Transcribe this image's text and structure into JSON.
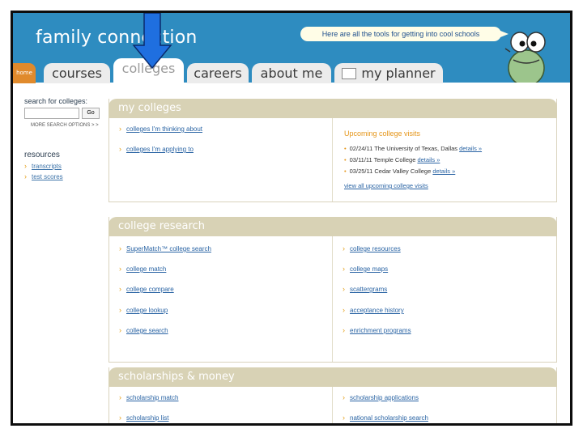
{
  "header": {
    "logo": "family connection",
    "speech": "Here are all the tools for getting into cool schools"
  },
  "tabs": [
    {
      "label": "home"
    },
    {
      "label": "courses"
    },
    {
      "label": "colleges"
    },
    {
      "label": "careers"
    },
    {
      "label": "about me"
    },
    {
      "label": "my planner"
    }
  ],
  "sidebar": {
    "search_label": "search for colleges:",
    "search_value": "",
    "go_label": "Go",
    "more_search": "MORE SEARCH OPTIONS > >",
    "resources_title": "resources",
    "resources": [
      "transcripts",
      "test scores"
    ]
  },
  "my_colleges": {
    "title": "my colleges",
    "links": [
      "colleges I'm thinking about",
      "colleges I'm applying to"
    ],
    "visits_title": "Upcoming college visits",
    "visits": [
      {
        "text": "02/24/11 The University of Texas, Dallas",
        "details": "details »"
      },
      {
        "text": "03/11/11 Temple College",
        "details": "details »"
      },
      {
        "text": "03/25/11 Cedar Valley College",
        "details": "details »"
      }
    ],
    "view_all": "view all upcoming college visits"
  },
  "college_research": {
    "title": "college research",
    "left": [
      "SuperMatch™ college search",
      "college match",
      "college compare",
      "college lookup",
      "college search"
    ],
    "right": [
      "college resources",
      "college maps",
      "scattergrams",
      "acceptance history",
      "enrichment programs"
    ]
  },
  "scholarships": {
    "title": "scholarships & money",
    "left": [
      "scholarship match",
      "scholarship list"
    ],
    "right": [
      "scholarship applications",
      "national scholarship search"
    ]
  },
  "colors": {
    "header_blue": "#2e8cc0",
    "panel_head": "#d8d2b5",
    "link_blue": "#2a64a4",
    "accent_orange": "#e5961a",
    "arrow_blue": "#1f6fe0"
  }
}
